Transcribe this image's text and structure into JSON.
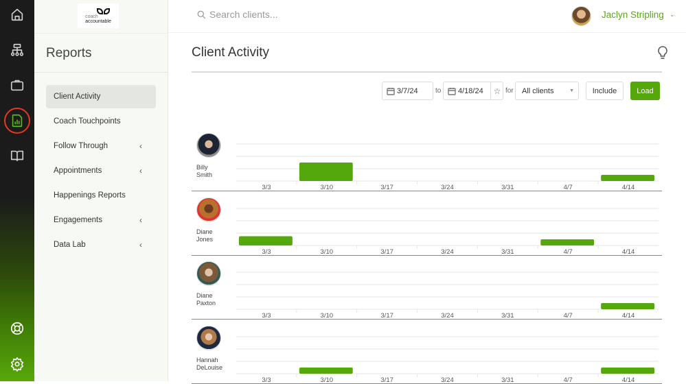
{
  "rail": {
    "icons": [
      "home-icon",
      "org-chart-icon",
      "briefcase-icon",
      "reports-icon",
      "book-icon",
      "lifebuoy-icon",
      "gear-icon"
    ],
    "active": "reports-icon"
  },
  "brand": {
    "line1": "coach",
    "line2": "accountable"
  },
  "subnav": {
    "title": "Reports",
    "items": [
      {
        "label": "Client Activity",
        "active": true,
        "expandable": false
      },
      {
        "label": "Coach Touchpoints",
        "active": false,
        "expandable": false
      },
      {
        "label": "Follow Through",
        "active": false,
        "expandable": true
      },
      {
        "label": "Appointments",
        "active": false,
        "expandable": true
      },
      {
        "label": "Happenings Reports",
        "active": false,
        "expandable": false
      },
      {
        "label": "Engagements",
        "active": false,
        "expandable": true
      },
      {
        "label": "Data Lab",
        "active": false,
        "expandable": true
      }
    ]
  },
  "topbar": {
    "search_placeholder": "Search clients...",
    "user_name": "Jaclyn Stripling",
    "user_chevron": "⌄"
  },
  "page": {
    "title": "Client Activity"
  },
  "filters": {
    "from_date": "3/7/24",
    "to_label": "to",
    "to_date": "4/18/24",
    "for_label": "for",
    "clients_select": "All clients",
    "include_label": "Include",
    "load_label": "Load"
  },
  "colors": {
    "accent": "#55a80c",
    "user_name": "#5aa61c",
    "active_ring": "#e53a1e"
  },
  "chart_data": {
    "type": "bar",
    "categories": [
      "3/3",
      "3/10",
      "3/17",
      "3/24",
      "3/31",
      "4/7",
      "4/14"
    ],
    "ylim": [
      0,
      3
    ],
    "grid": true,
    "series": [
      {
        "name": "Billy Smith",
        "first": "Billy",
        "last": "Smith",
        "values": [
          0,
          1.5,
          0,
          0,
          0,
          0,
          0.5
        ]
      },
      {
        "name": "Diane Jones",
        "first": "Diane",
        "last": "Jones",
        "values": [
          0.75,
          0,
          0,
          0,
          0,
          0.5,
          0
        ]
      },
      {
        "name": "Diane Paxton",
        "first": "Diane",
        "last": "Paxton",
        "values": [
          0,
          0,
          0,
          0,
          0,
          0,
          0.5
        ]
      },
      {
        "name": "Hannah DeLouise",
        "first": "Hannah",
        "last": "DeLouise",
        "values": [
          0,
          0.5,
          0,
          0,
          0,
          0,
          0.5
        ]
      }
    ]
  }
}
